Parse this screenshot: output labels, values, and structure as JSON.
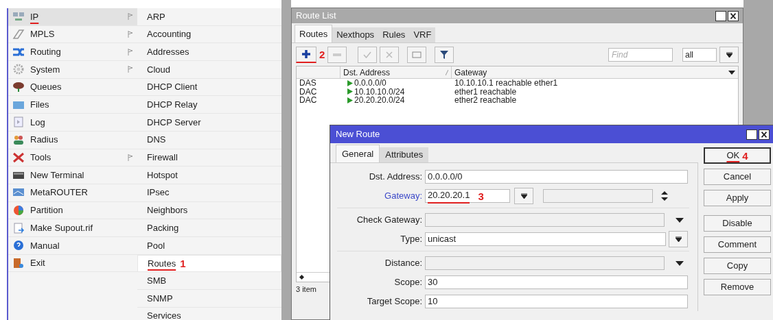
{
  "main_menu": {
    "items": [
      {
        "label": "IP",
        "kind": "network",
        "submenu": true,
        "selected": true,
        "underlined": true
      },
      {
        "label": "MPLS",
        "kind": "mpls",
        "submenu": true,
        "selected": false,
        "underlined": false
      },
      {
        "label": "Routing",
        "kind": "routing",
        "submenu": true,
        "selected": false,
        "underlined": false
      },
      {
        "label": "System",
        "kind": "gear",
        "submenu": true,
        "selected": false,
        "underlined": false
      },
      {
        "label": "Queues",
        "kind": "queues",
        "submenu": false,
        "selected": false,
        "underlined": false
      },
      {
        "label": "Files",
        "kind": "folder",
        "submenu": false,
        "selected": false,
        "underlined": false
      },
      {
        "label": "Log",
        "kind": "document",
        "submenu": false,
        "selected": false,
        "underlined": false
      },
      {
        "label": "Radius",
        "kind": "people",
        "submenu": false,
        "selected": false,
        "underlined": false
      },
      {
        "label": "Tools",
        "kind": "tools",
        "submenu": true,
        "selected": false,
        "underlined": false
      },
      {
        "label": "New Terminal",
        "kind": "terminal",
        "submenu": false,
        "selected": false,
        "underlined": false
      },
      {
        "label": "MetaROUTER",
        "kind": "monitor",
        "submenu": false,
        "selected": false,
        "underlined": false
      },
      {
        "label": "Partition",
        "kind": "pie",
        "submenu": false,
        "selected": false,
        "underlined": false
      },
      {
        "label": "Make Supout.rif",
        "kind": "file",
        "submenu": false,
        "selected": false,
        "underlined": false
      },
      {
        "label": "Manual",
        "kind": "help",
        "submenu": false,
        "selected": false,
        "underlined": false
      },
      {
        "label": "Exit",
        "kind": "exit",
        "submenu": false,
        "selected": false,
        "underlined": false
      }
    ]
  },
  "ip_submenu": {
    "items": [
      {
        "label": "ARP",
        "selected": false
      },
      {
        "label": "Accounting",
        "selected": false
      },
      {
        "label": "Addresses",
        "selected": false
      },
      {
        "label": "Cloud",
        "selected": false
      },
      {
        "label": "DHCP Client",
        "selected": false
      },
      {
        "label": "DHCP Relay",
        "selected": false
      },
      {
        "label": "DHCP Server",
        "selected": false
      },
      {
        "label": "DNS",
        "selected": false
      },
      {
        "label": "Firewall",
        "selected": false
      },
      {
        "label": "Hotspot",
        "selected": false
      },
      {
        "label": "IPsec",
        "selected": false
      },
      {
        "label": "Neighbors",
        "selected": false
      },
      {
        "label": "Packing",
        "selected": false
      },
      {
        "label": "Pool",
        "selected": false
      },
      {
        "label": "Routes",
        "selected": true,
        "step": "1"
      },
      {
        "label": "SMB",
        "selected": false
      },
      {
        "label": "SNMP",
        "selected": false
      },
      {
        "label": "Services",
        "selected": false
      }
    ]
  },
  "route_list": {
    "title": "Route List",
    "tabs": [
      {
        "label": "Routes",
        "selected": true
      },
      {
        "label": "Nexthops",
        "selected": false
      },
      {
        "label": "Rules",
        "selected": false
      },
      {
        "label": "VRF",
        "selected": false
      }
    ],
    "add_step": "2",
    "find": {
      "placeholder": "Find"
    },
    "filter": {
      "value": "all"
    },
    "table": {
      "columns": [
        "Dst. Address",
        "Gateway"
      ],
      "rows": [
        {
          "flags": "DAS",
          "dst": "0.0.0.0/0",
          "gateway": "10.10.10.1 reachable ether1"
        },
        {
          "flags": "DAC",
          "dst": "10.10.10.0/24",
          "gateway": "ether1 reachable"
        },
        {
          "flags": "DAC",
          "dst": "20.20.20.0/24",
          "gateway": "ether2 reachable"
        }
      ]
    },
    "status_bar": "3 item"
  },
  "new_route": {
    "title": "New Route",
    "tabs": [
      {
        "label": "General",
        "selected": true
      },
      {
        "label": "Attributes",
        "selected": false
      }
    ],
    "fields": [
      {
        "kind": "text",
        "label": "Dst. Address:",
        "value": "0.0.0.0/0",
        "highlighted": false
      },
      {
        "kind": "gateway",
        "label": "Gateway:",
        "value": "20.20.20.1",
        "step": "3",
        "highlighted": true
      },
      {
        "kind": "separator"
      },
      {
        "kind": "dropdown",
        "label": "Check Gateway:",
        "highlighted": false
      },
      {
        "kind": "select",
        "label": "Type:",
        "value": "unicast",
        "highlighted": false
      },
      {
        "kind": "separator"
      },
      {
        "kind": "dropdown",
        "label": "Distance:",
        "highlighted": false
      },
      {
        "kind": "text",
        "label": "Scope:",
        "value": "30",
        "highlighted": false
      },
      {
        "kind": "text",
        "label": "Target Scope:",
        "value": "10",
        "highlighted": false
      }
    ],
    "buttons": [
      {
        "label": "OK",
        "step": "4",
        "default": true
      },
      {
        "label": "Cancel",
        "default": false
      },
      {
        "label": "Apply",
        "default": false
      },
      {
        "label": "Disable",
        "default": false
      },
      {
        "label": "Comment",
        "default": false
      },
      {
        "label": "Copy",
        "default": false
      },
      {
        "label": "Remove",
        "default": false
      }
    ]
  }
}
